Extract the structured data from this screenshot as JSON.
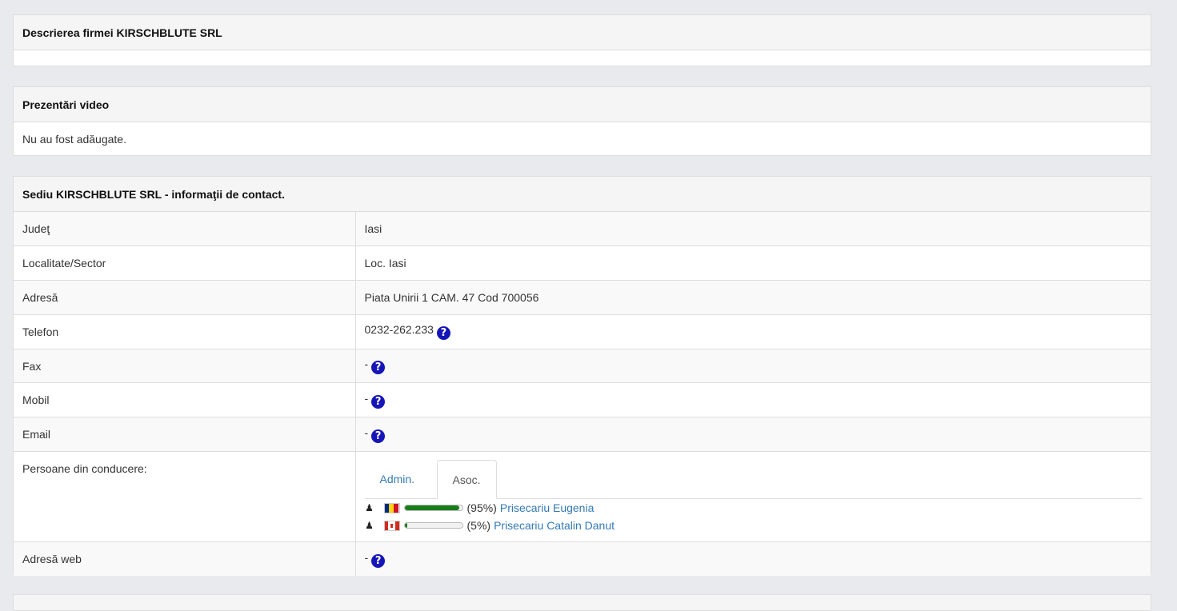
{
  "description_panel": {
    "title": "Descrierea firmei KIRSCHBLUTE SRL"
  },
  "video_panel": {
    "title": "Prezentări video",
    "body": "Nu au fost adăugate."
  },
  "contact_panel": {
    "title": "Sediu KIRSCHBLUTE SRL - informaţii de contact.",
    "rows": [
      {
        "label": "Judeţ",
        "value": "Iasi"
      },
      {
        "label": "Localitate/Sector",
        "value": "Loc. Iasi"
      },
      {
        "label": "Adresă",
        "value": "Piata Unirii 1 CAM. 47 Cod 700056"
      },
      {
        "label": "Telefon",
        "value": "0232-262.233"
      },
      {
        "label": "Fax",
        "value": "-"
      },
      {
        "label": "Mobil",
        "value": "-"
      },
      {
        "label": "Email",
        "value": "-"
      },
      {
        "label": "Persoane din conducere:",
        "value": ""
      },
      {
        "label": "Adresă web",
        "value": "-"
      }
    ],
    "help_glyph": "?",
    "person_glyph": "♟",
    "tabs": {
      "admin": "Admin.",
      "asoc": "Asoc.",
      "active": "asoc"
    },
    "associates": [
      {
        "share_text": "(95%)",
        "share": 95,
        "name": "Prisecariu Eugenia",
        "flag": "romania-flag"
      },
      {
        "share_text": "(5%)",
        "share": 5,
        "name": "Prisecariu Catalin Danut",
        "flag": "canada-flag"
      }
    ],
    "colors": {
      "link": "#337ab7",
      "help_icon": "#1616b8",
      "share_bar": "#1a7d1a"
    }
  }
}
